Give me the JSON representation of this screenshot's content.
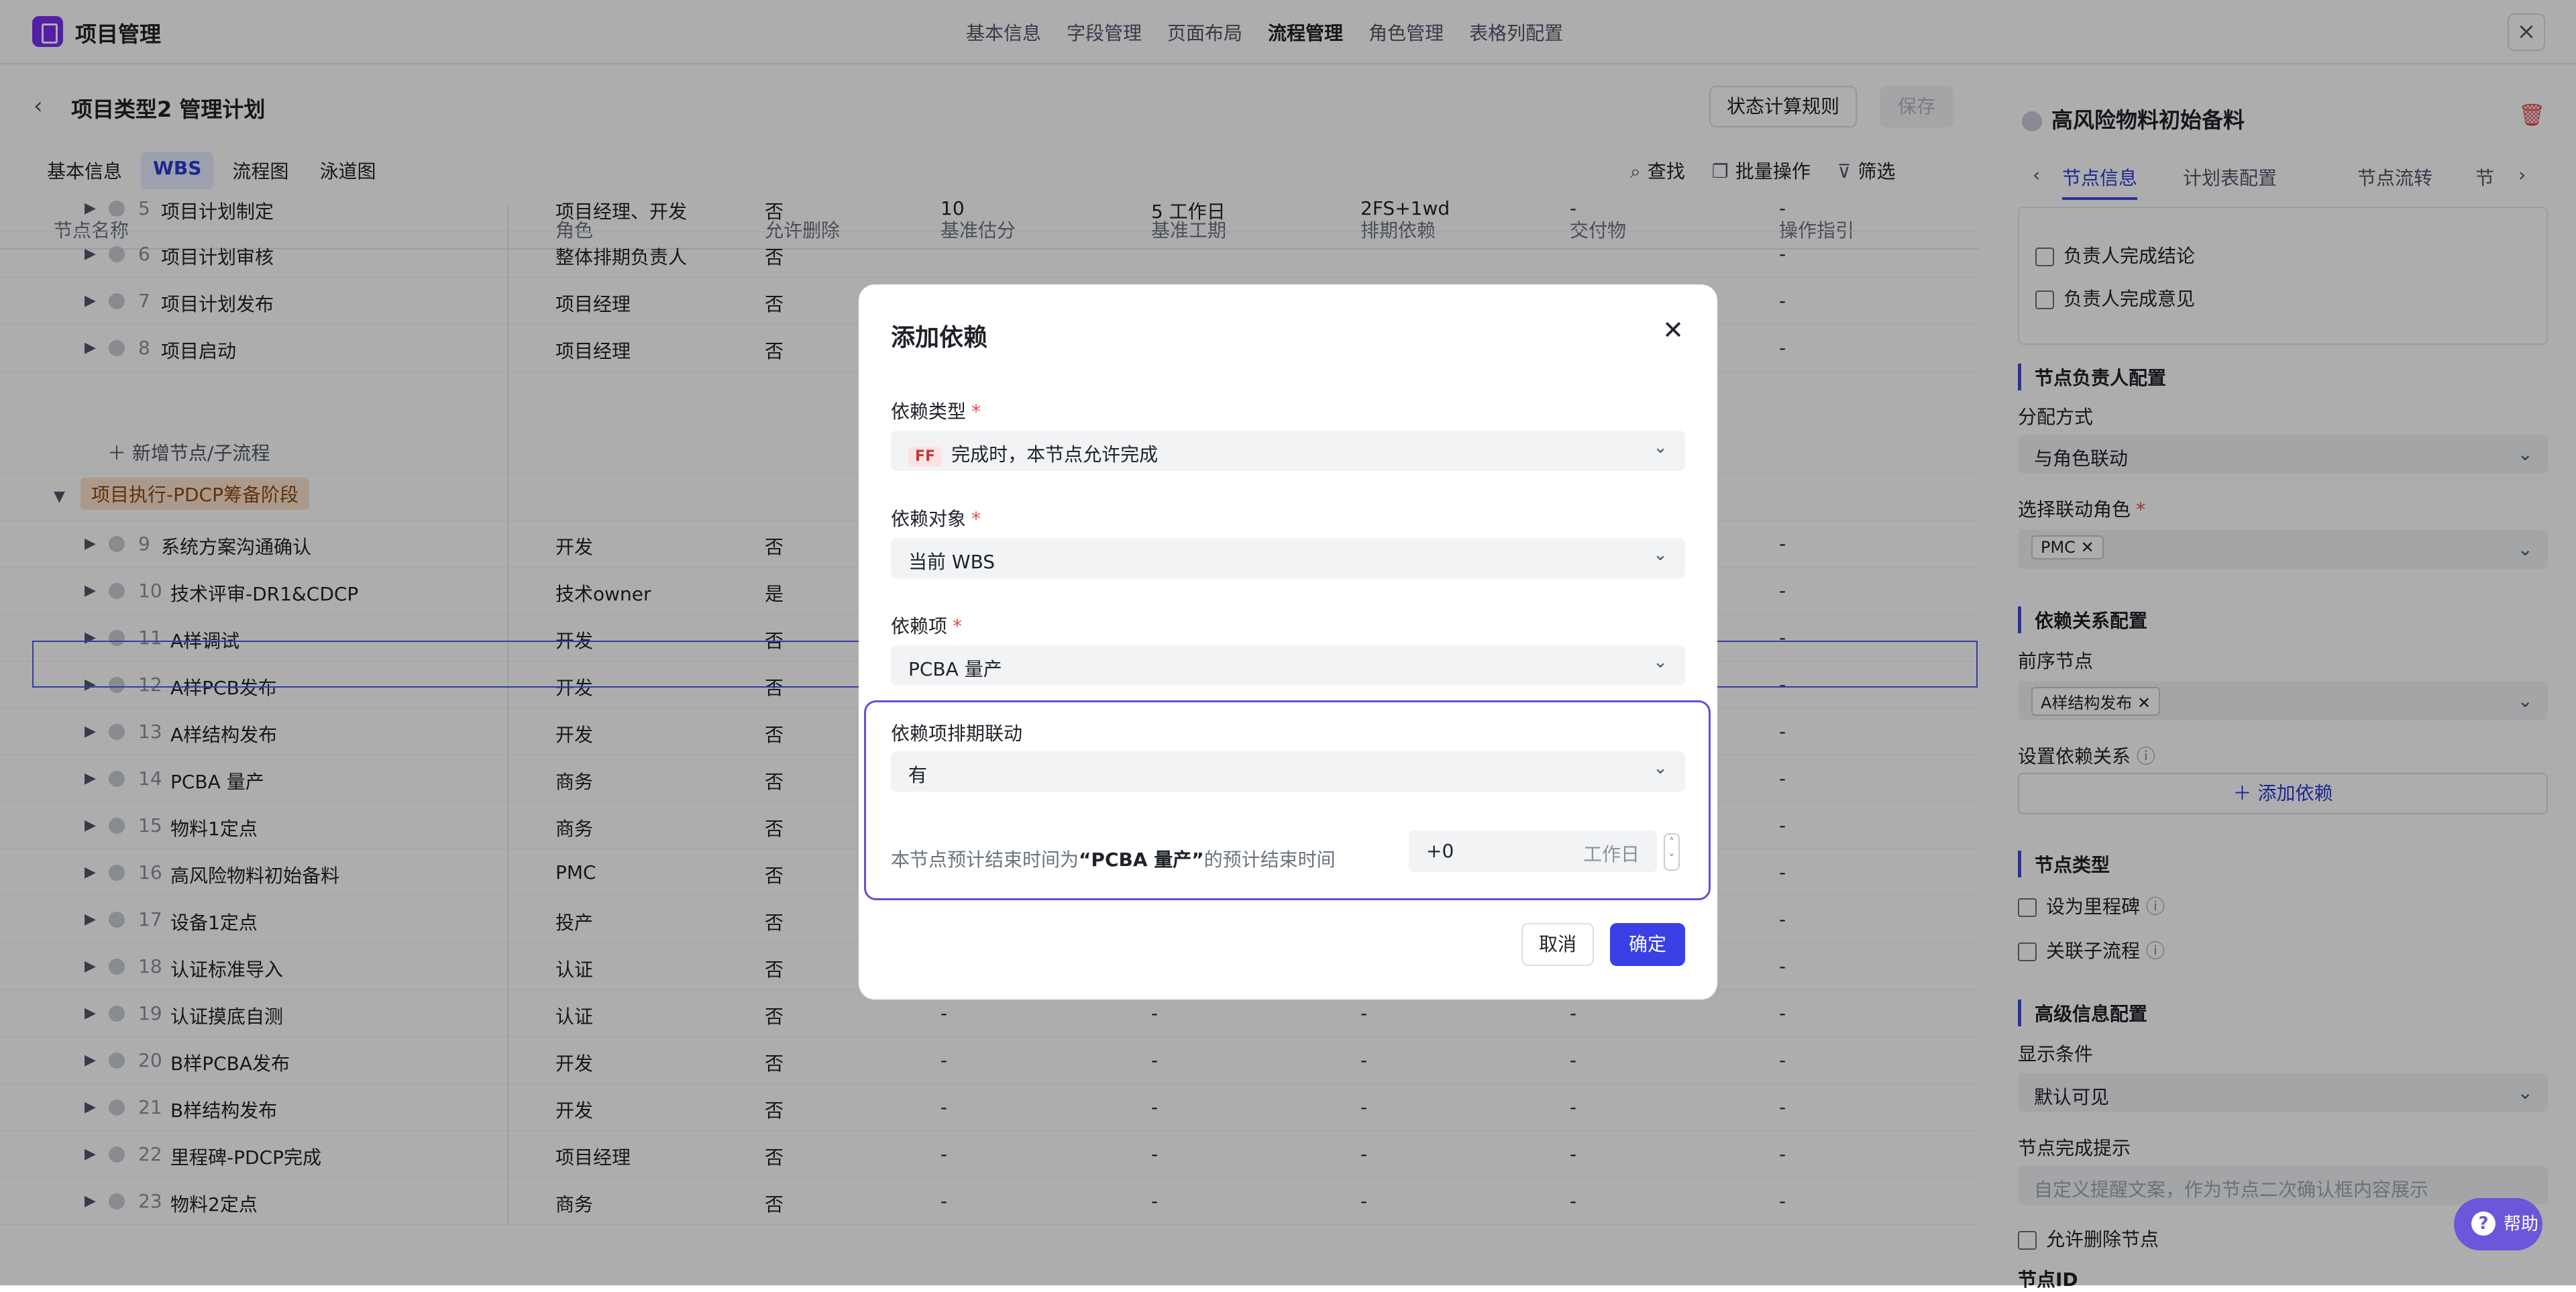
{
  "app": {
    "title": "项目管理",
    "nav": [
      "基本信息",
      "字段管理",
      "页面布局",
      "流程管理",
      "角色管理",
      "表格列配置"
    ],
    "nav_active": "流程管理"
  },
  "header": {
    "title": "项目类型2 管理计划",
    "rule_button": "状态计算规则",
    "save_button": "保存"
  },
  "subtabs": [
    "基本信息",
    "WBS",
    "流程图",
    "泳道图"
  ],
  "tools": [
    "查找",
    "批量操作",
    "筛选"
  ],
  "table": {
    "columns": [
      "节点名称",
      "角色",
      "允许删除",
      "基准估分",
      "基准工期",
      "排期依赖",
      "交付物",
      "操作指引"
    ],
    "rows": [
      {
        "num": "5",
        "name": "项目计划制定",
        "role": "项目经理、开发",
        "del": "否",
        "score": "10",
        "dur": "5 工作日",
        "dep": "2FS+1wd",
        "out": "-",
        "guide": "-"
      },
      {
        "num": "6",
        "name": "项目计划审核",
        "role": "整体排期负责人",
        "del": "否",
        "guide": "-"
      },
      {
        "num": "7",
        "name": "项目计划发布",
        "role": "项目经理",
        "del": "否",
        "guide": "-"
      },
      {
        "num": "8",
        "name": "项目启动",
        "role": "项目经理",
        "del": "否",
        "guide": "-"
      },
      {
        "num": "9",
        "name": "系统方案沟通确认",
        "role": "开发",
        "del": "否",
        "guide": "-"
      },
      {
        "num": "10",
        "name": "技术评审-DR1&CDCP",
        "role": "技术owner",
        "del": "是",
        "guide": "-"
      },
      {
        "num": "11",
        "name": "A样调试",
        "role": "开发",
        "del": "否",
        "guide": "-"
      },
      {
        "num": "12",
        "name": "A样PCB发布",
        "role": "开发",
        "del": "否",
        "guide": "-"
      },
      {
        "num": "13",
        "name": "A样结构发布",
        "role": "开发",
        "del": "否",
        "guide": "-"
      },
      {
        "num": "14",
        "name": "PCBA 量产",
        "role": "商务",
        "del": "否",
        "guide": "-"
      },
      {
        "num": "15",
        "name": "物料1定点",
        "role": "商务",
        "del": "否",
        "guide": "-"
      },
      {
        "num": "16",
        "name": "高风险物料初始备料",
        "role": "PMC",
        "del": "否",
        "guide": "-"
      },
      {
        "num": "17",
        "name": "设备1定点",
        "role": "投产",
        "del": "否",
        "guide": "-"
      },
      {
        "num": "18",
        "name": "认证标准导入",
        "role": "认证",
        "del": "否",
        "guide": "-"
      },
      {
        "num": "19",
        "name": "认证摸底自测",
        "role": "认证",
        "del": "否",
        "score": "-",
        "dur": "-",
        "dep": "-",
        "out": "-",
        "guide": "-"
      },
      {
        "num": "20",
        "name": "B样PCBA发布",
        "role": "开发",
        "del": "否",
        "score": "-",
        "dur": "-",
        "dep": "-",
        "out": "-",
        "guide": "-"
      },
      {
        "num": "21",
        "name": "B样结构发布",
        "role": "开发",
        "del": "否",
        "score": "-",
        "dur": "-",
        "dep": "-",
        "out": "-",
        "guide": "-"
      },
      {
        "num": "22",
        "name": "里程碑-PDCP完成",
        "role": "项目经理",
        "del": "否",
        "score": "-",
        "dur": "-",
        "dep": "-",
        "out": "-",
        "guide": "-"
      },
      {
        "num": "23",
        "name": "物料2定点",
        "role": "商务",
        "del": "否",
        "score": "-",
        "dur": "-",
        "dep": "-",
        "out": "-",
        "guide": "-"
      }
    ],
    "add_node": "新增节点/子流程",
    "phase": "项目执行-PDCP筹备阶段"
  },
  "right_panel": {
    "title": "高风险物料初始备料",
    "tabs": [
      "节点信息",
      "计划表配置",
      "节点流转",
      "节"
    ],
    "checks_top": [
      "负责人完成结论",
      "负责人完成意见"
    ],
    "owner_section": "节点负责人配置",
    "assign_label": "分配方式",
    "assign_value": "与角色联动",
    "role_label": "选择联动角色",
    "role_tag": "PMC",
    "dep_section": "依赖关系配置",
    "pre_label": "前序节点",
    "pre_tag": "A样结构发布",
    "set_dep_label": "设置依赖关系",
    "add_dep": "添加依赖",
    "type_section": "节点类型",
    "type_checks": [
      "设为里程碑",
      "关联子流程"
    ],
    "adv_section": "高级信息配置",
    "display_label": "显示条件",
    "display_value": "默认可见",
    "hint_label": "节点完成提示",
    "hint_placeholder": "自定义提醒文案，作为节点二次确认框内容展示",
    "allow_delete": "允许删除节点",
    "node_id": "节点ID"
  },
  "modal": {
    "title": "添加依赖",
    "type_label": "依赖类型",
    "type_badge": "FF",
    "type_value": "完成时，本节点允许完成",
    "target_label": "依赖对象",
    "target_value": "当前 WBS",
    "item_label": "依赖项",
    "item_value": "PCBA 量产",
    "link_label": "依赖项排期联动",
    "link_value": "有",
    "note_pre": "本节点预计结束时间为",
    "note_item": "“PCBA 量产”",
    "note_post": "的预计结束时间",
    "offset_value": "+0",
    "offset_unit": "工作日",
    "cancel": "取消",
    "ok": "确定"
  },
  "help": "帮助"
}
